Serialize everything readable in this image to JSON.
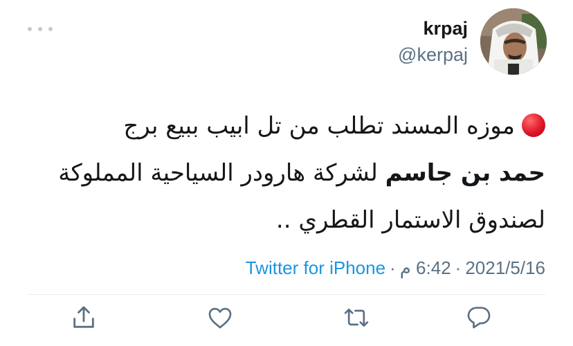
{
  "tweet": {
    "display_name": "krpaj",
    "handle": "@kerpaj",
    "lines": [
      "موزه المسند تطلب من تل ابيب ببيع برج",
      "حمد بن جاسم",
      "لشركة هارودر السياحية المملوكة",
      "لصندوق الاستمار القطري .."
    ],
    "timestamp_time": "6:42 م",
    "timestamp_date": "2021/5/16",
    "source": "Twitter for iPhone",
    "separator": "·"
  },
  "colors": {
    "text": "#14171a",
    "secondary": "#5b7083",
    "link": "#1b95e0",
    "red_dot": "#e0162a",
    "icon": "#5b7083"
  },
  "icons": {
    "more": "more-dots-icon",
    "reply": "reply-icon",
    "retweet": "retweet-icon",
    "like": "heart-icon",
    "share": "share-icon"
  }
}
